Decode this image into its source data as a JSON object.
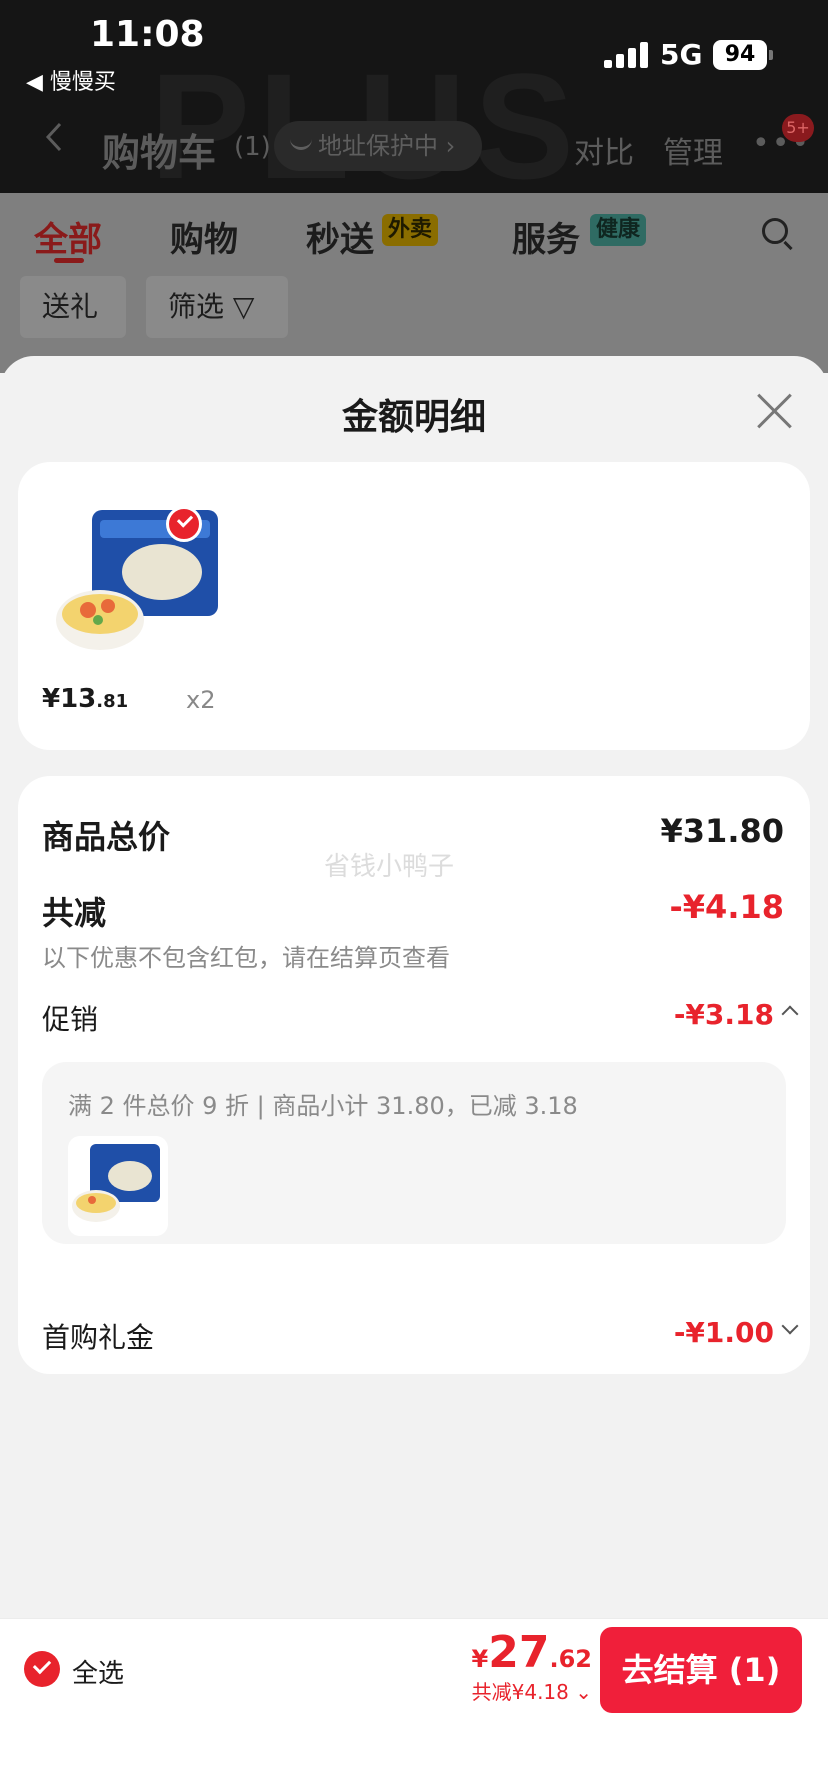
{
  "status_bar": {
    "time": "11:08",
    "back_app": "◀ 慢慢买",
    "network": "5G",
    "battery": "94"
  },
  "header": {
    "title": "购物车",
    "count": "(1)",
    "address_protection": "地址保护中 ›",
    "compare": "对比",
    "manage": "管理",
    "more": "•••",
    "more_badge": "5+"
  },
  "tabs": [
    {
      "label": "全部"
    },
    {
      "label": "购物"
    },
    {
      "label": "秒送",
      "tag": "外卖"
    },
    {
      "label": "服务",
      "tag": "健康"
    }
  ],
  "chips": {
    "gift": "送礼",
    "filter": "筛选 ▽"
  },
  "sheet": {
    "title": "金额明细",
    "product": {
      "price_main": "¥13",
      "price_cents": ".81",
      "qty": "x2"
    },
    "total_label": "商品总价",
    "total_value": "¥31.80",
    "watermark": "省钱小鸭子",
    "discount_label": "共减",
    "discount_value": "-¥4.18",
    "discount_note": "以下优惠不包含红包，请在结算页查看",
    "promo_label": "促销",
    "promo_value": "-¥3.18",
    "promo_desc": "满 2 件总价 9 折 | 商品小计 31.80，已减 3.18",
    "gift_label": "首购礼金",
    "gift_value": "-¥1.00"
  },
  "checkout": {
    "select_all": "全选",
    "total_yen": "¥",
    "total_main": "27",
    "total_cents": ".62",
    "total_saved": "共减¥4.18 ⌄",
    "button": "去结算 (1)"
  },
  "colors": {
    "accent_red": "#e8232c",
    "checkout_red": "#f01f3a"
  }
}
